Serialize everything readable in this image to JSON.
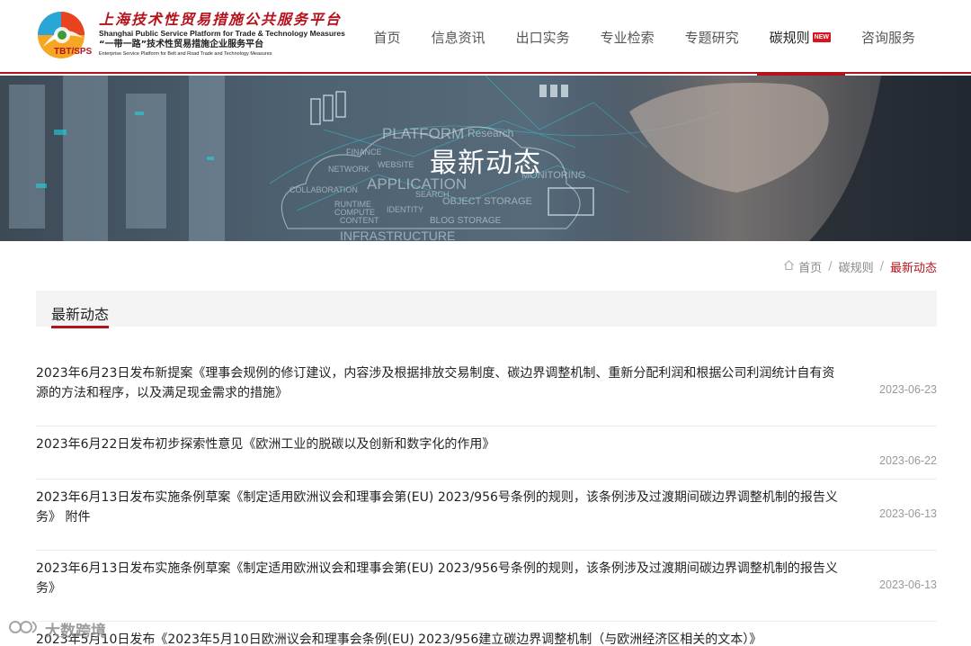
{
  "logo": {
    "name_cn": "上海技术性贸易措施公共服务平台",
    "name_en": "Shanghai Public Service Platform for Trade & Technology Measures",
    "sub_cn": "“一带一路”技术性贸易措施企业服务平台",
    "sub_en": "Enterprise Service Platform for Belt and Road Trade and Technology Measures",
    "mark_text": "TBT/SPS"
  },
  "nav": {
    "items": [
      {
        "label": "首页"
      },
      {
        "label": "信息资讯"
      },
      {
        "label": "出口实务"
      },
      {
        "label": "专业检索"
      },
      {
        "label": "专题研究"
      },
      {
        "label": "碳规则",
        "badge": "NEW",
        "active": true
      },
      {
        "label": "咨询服务"
      }
    ]
  },
  "banner": {
    "title": "最新动态",
    "bg_words": [
      "PLATFORM",
      "Research",
      "COMPUTE",
      "FINANCE",
      "WEBSITE",
      "NETWORK",
      "APPLICATION",
      "MONITORING",
      "COLLABORATION",
      "SEARCH",
      "OBJECT STORAGE",
      "RUNTIME",
      "IDENTITY",
      "CONTENT",
      "BLOG STORAGE",
      "INFRASTRUCTURE"
    ]
  },
  "breadcrumb": {
    "home": "首页",
    "parent": "碳规则",
    "current": "最新动态",
    "sep": "/"
  },
  "section": {
    "title": "最新动态"
  },
  "articles": [
    {
      "title": "2023年6月23日发布新提案《理事会规例的修订建议，内容涉及根据排放交易制度、碳边界调整机制、重新分配利润和根据公司利润统计自有资源的方法和程序，以及满足现金需求的措施》",
      "date": "2023-06-23"
    },
    {
      "title": "2023年6月22日发布初步探索性意见《欧洲工业的脱碳以及创新和数字化的作用》",
      "date": "2023-06-22"
    },
    {
      "title": "2023年6月13日发布实施条例草案《制定适用欧洲议会和理事会第(EU) 2023/956号条例的规则，该条例涉及过渡期间碳边界调整机制的报告义务》 附件",
      "date": "2023-06-13"
    },
    {
      "title": "2023年6月13日发布实施条例草案《制定适用欧洲议会和理事会第(EU) 2023/956号条例的规则，该条例涉及过渡期间碳边界调整机制的报告义务》",
      "date": "2023-06-13"
    },
    {
      "title": "2023年5月10日发布《2023年5月10日欧洲议会和理事会条例(EU) 2023/956建立碳边界调整机制（与欧洲经济区相关的文本）》",
      "date": ""
    }
  ],
  "watermark": {
    "text": "大数跨境"
  },
  "colors": {
    "accent": "#b5121b",
    "badge": "#d8141f",
    "text": "#222222",
    "muted": "#999999"
  }
}
